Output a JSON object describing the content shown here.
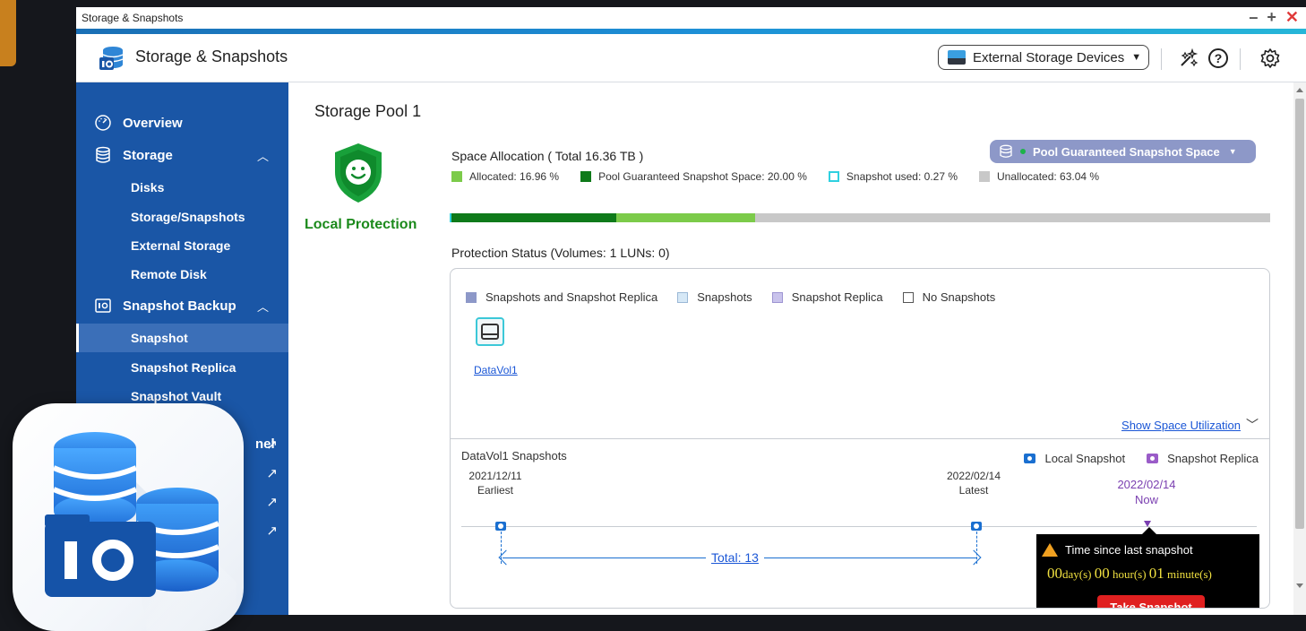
{
  "window": {
    "title": "Storage & Snapshots",
    "controls": {
      "minimize": "–",
      "maximize": "+",
      "close": "✕"
    }
  },
  "appbar": {
    "title": "Storage & Snapshots",
    "external_select": "External Storage Devices",
    "icons": [
      "wand-icon",
      "help-icon",
      "gear-icon"
    ]
  },
  "sidebar": {
    "overview": "Overview",
    "storage": "Storage",
    "storage_items": [
      "Disks",
      "Storage/Snapshots",
      "External Storage",
      "Remote Disk"
    ],
    "snapshot_backup": "Snapshot Backup",
    "snapshot_items": [
      "Snapshot",
      "Snapshot Replica",
      "Snapshot Vault"
    ],
    "active_item": "Snapshot",
    "partial_label": "nel"
  },
  "main": {
    "pool_title": "Storage Pool 1",
    "protection_label": "Local Protection",
    "space_title": "Space Allocation ( Total 16.36 TB )",
    "pgs_button": "Pool Guaranteed Snapshot Space",
    "allocation_legend": [
      {
        "label": "Allocated: 16.96 %",
        "color": "#7ccb4a",
        "percent": 16.96
      },
      {
        "label": "Pool Guaranteed Snapshot Space: 20.00 %",
        "color": "#0f7a1a",
        "percent": 20.0
      },
      {
        "label": "Snapshot used: 0.27 %",
        "color": "#2fd0e0",
        "percent": 0.27
      },
      {
        "label": "Unallocated: 63.04 %",
        "color": "#c8c8c8",
        "percent": 63.04
      }
    ],
    "protection_title": "Protection Status (Volumes: 1 LUNs: 0)",
    "protection_legend": [
      {
        "label": "Snapshots and Snapshot Replica",
        "color": "#8d98c8"
      },
      {
        "label": "Snapshots",
        "color": "#d6e8f6"
      },
      {
        "label": "Snapshot Replica",
        "color": "#c9c3ec"
      },
      {
        "label": "No Snapshots",
        "color": "#ffffff"
      }
    ],
    "volume_label": "DataVol1",
    "show_space": "Show Space Utilization",
    "snap_title": "DataVol1 Snapshots",
    "snap_legend_local": "Local Snapshot",
    "snap_legend_replica": "Snapshot Replica",
    "earliest_date": "2021/12/11",
    "earliest_label": "Earliest",
    "latest_date": "2022/02/14",
    "latest_label": "Latest",
    "now_date": "2022/02/14",
    "now_label": "Now",
    "total_label": "Total: 13",
    "tooltip": {
      "title": "Time since last snapshot",
      "days": "00",
      "days_unit": "day(s)",
      "hours": "00",
      "hours_unit": "hour(s)",
      "minutes": "01",
      "minutes_unit": "minute(s)",
      "button": "Take Snapshot"
    }
  },
  "colors": {
    "sidebar": "#1a56a6",
    "accent_blue": "#1a6fd0",
    "green": "#1c8a1c",
    "purple": "#7a3fb0",
    "danger": "#e02020"
  }
}
